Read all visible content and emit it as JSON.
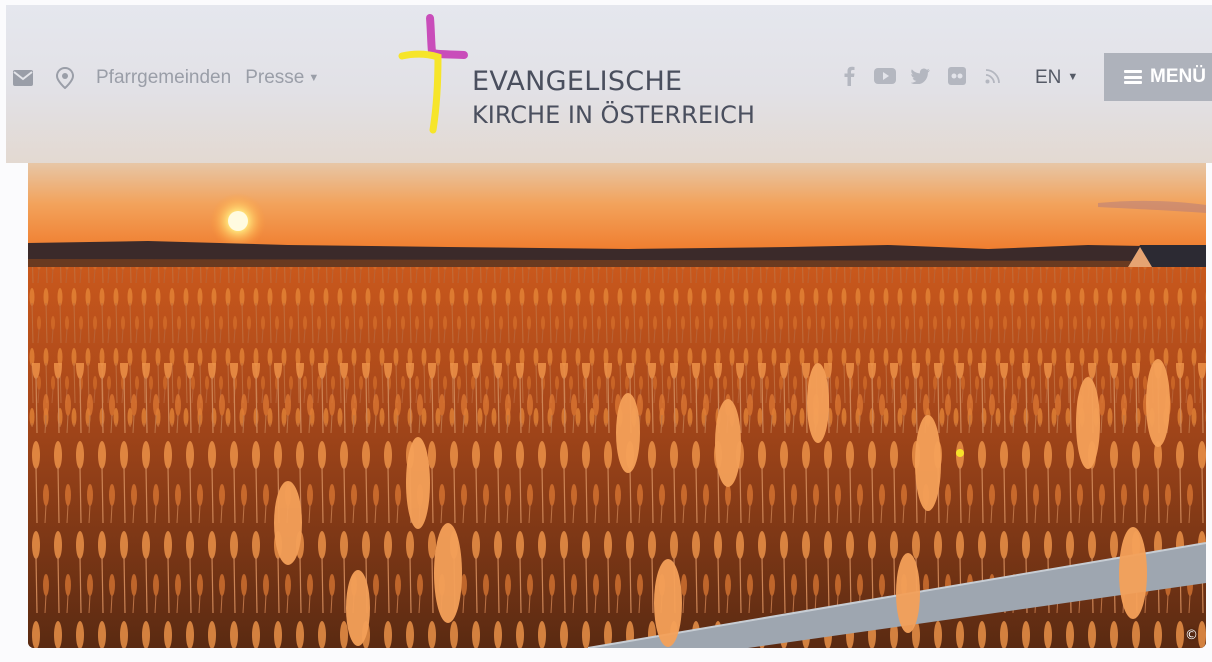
{
  "nav": {
    "mail_icon": "envelope-icon",
    "location_icon": "map-pin-icon",
    "pfarrgemeinden": "Pfarrgemeinden",
    "presse": "Presse",
    "dropdown_caret": "▼"
  },
  "logo": {
    "line1": "EVANGELISCHE",
    "line2": "KIRCHE IN ÖSTERREICH",
    "colors": {
      "cross_top": "#c94dba",
      "cross_bottom": "#f6e52a",
      "text": "#4a4f5e"
    }
  },
  "social": {
    "icons": [
      "facebook-icon",
      "youtube-icon",
      "twitter-icon",
      "flickr-icon",
      "rss-icon"
    ]
  },
  "language": {
    "current": "EN",
    "caret": "▼"
  },
  "menu": {
    "label": "MENÜ",
    "icon": "hamburger-icon",
    "bg": "#aeb2bb"
  },
  "hero": {
    "alt": "Sunset over reed field",
    "copyright": "©"
  }
}
